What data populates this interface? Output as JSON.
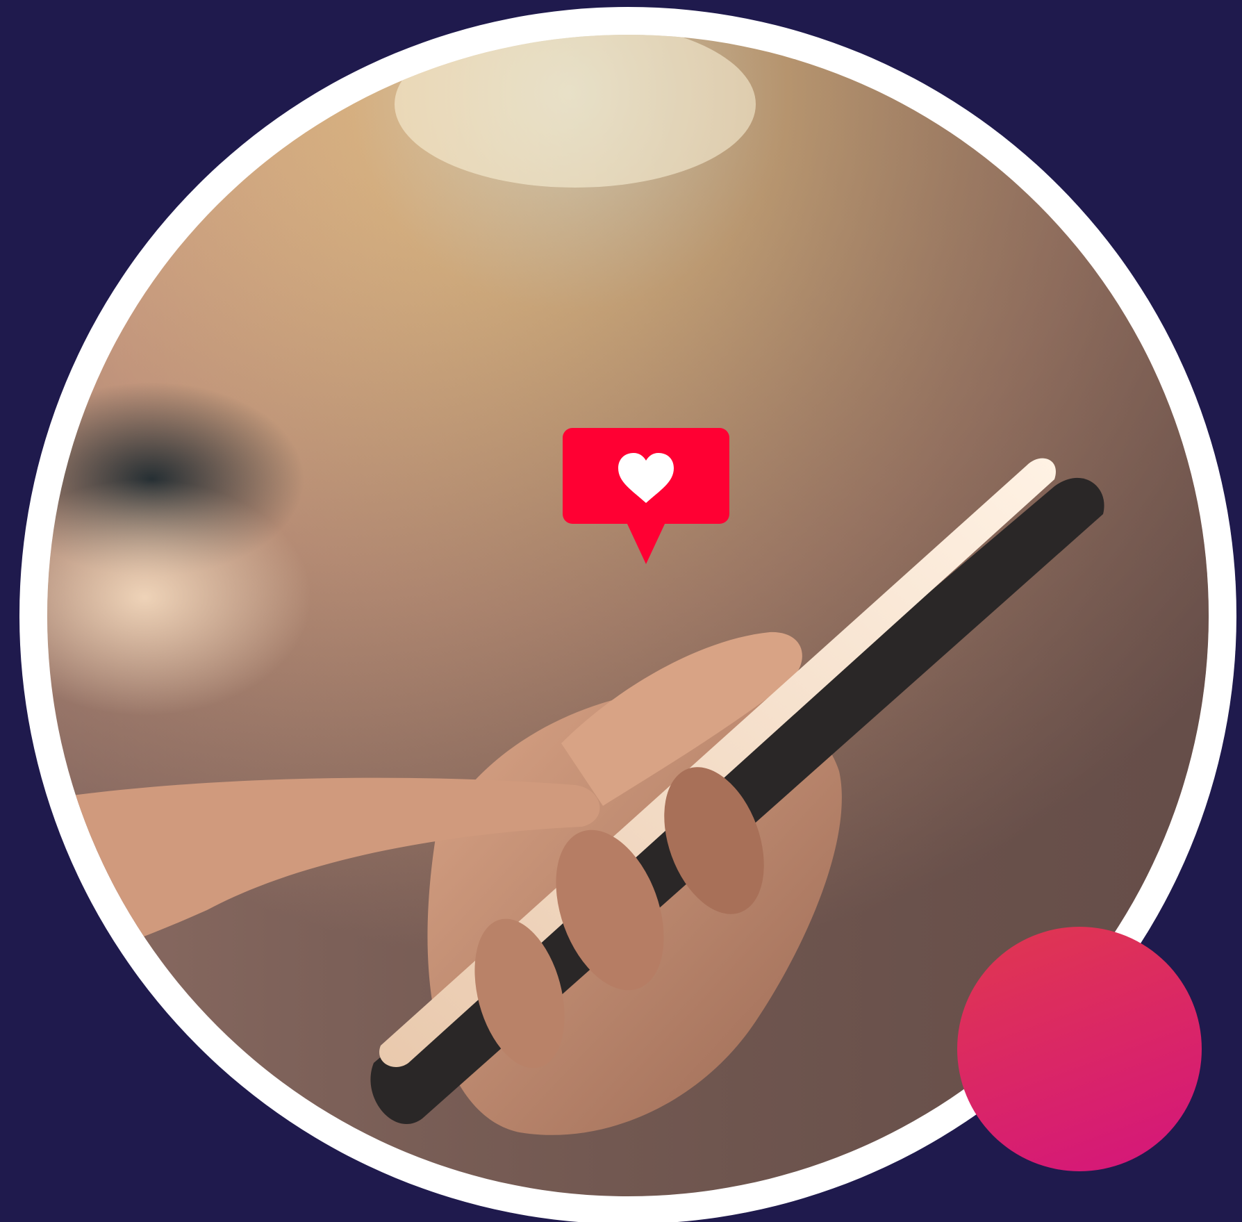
{
  "colors": {
    "background": "#1f1a4d",
    "frame": "#ffffff",
    "like_badge": "#ff0033",
    "like_heart": "#ffffff",
    "accent_gradient_top": "#e0384f",
    "accent_gradient_bottom": "#d4157c"
  },
  "icons": {
    "like_notification": "heart-notification-icon"
  },
  "image": {
    "subject": "hand-holding-smartphone-photo"
  }
}
